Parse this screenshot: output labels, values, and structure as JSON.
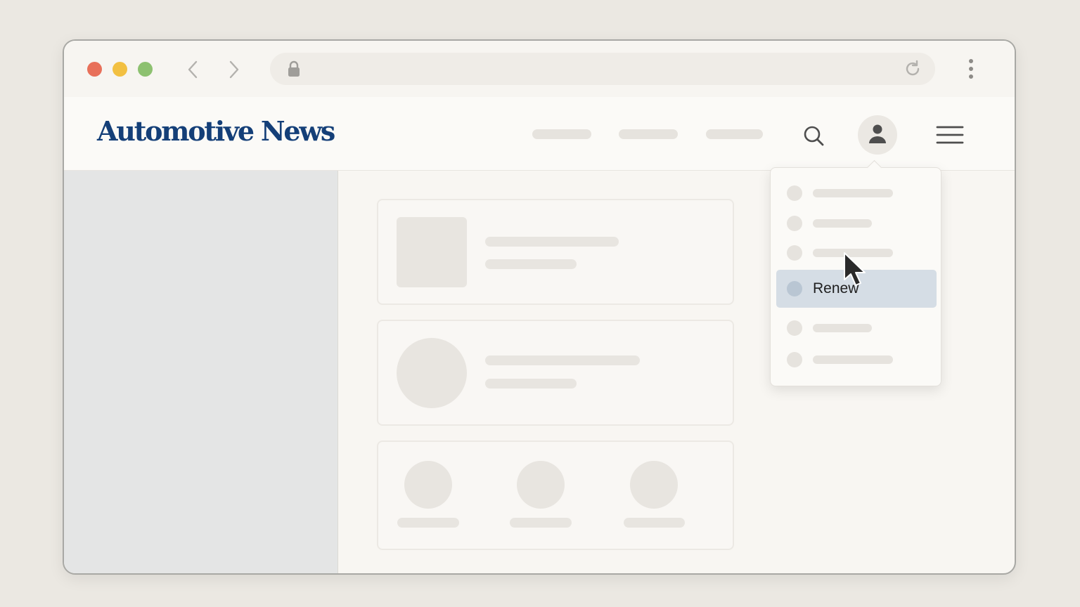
{
  "brand": {
    "name": "Automotive News",
    "color": "#143f78"
  },
  "browser": {
    "traffic_lights": [
      "#e8705a",
      "#f2c042",
      "#8dc170"
    ],
    "icons": [
      "chevron-left-icon",
      "chevron-right-icon",
      "lock-icon",
      "reload-icon",
      "kebab-menu-icon"
    ]
  },
  "header": {
    "icons": [
      "search-icon",
      "user-icon",
      "hamburger-icon"
    ]
  },
  "account_menu": {
    "items": [
      {
        "label": ""
      },
      {
        "label": ""
      },
      {
        "label": ""
      },
      {
        "label": "Renew",
        "hovered": true
      },
      {
        "label": ""
      },
      {
        "label": ""
      }
    ],
    "highlight_color": "#d5dde5"
  }
}
